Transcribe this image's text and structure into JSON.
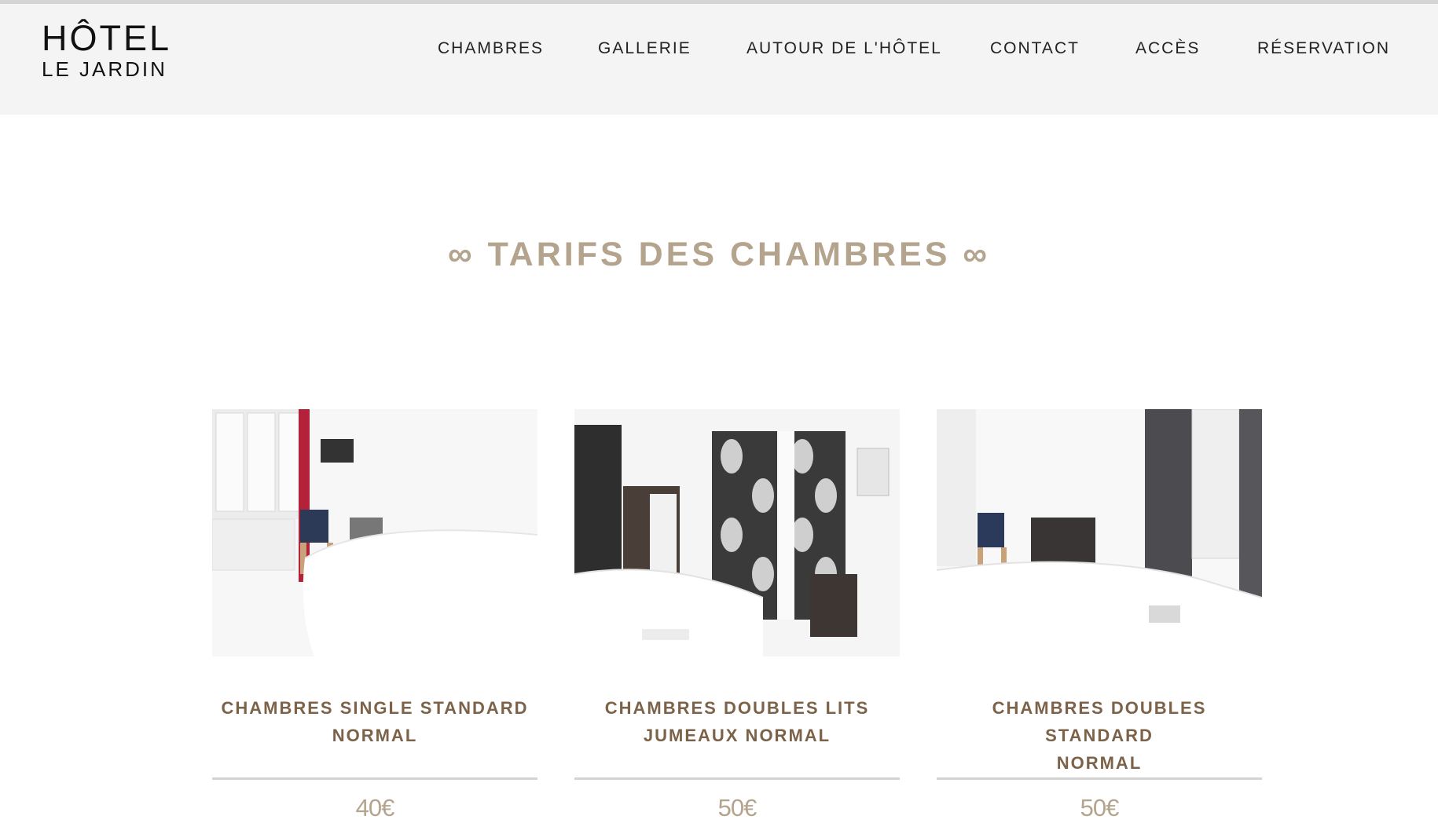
{
  "header": {
    "logo_line1": "HÔTEL",
    "logo_line2": "LE JARDIN",
    "nav": [
      {
        "label": "CHAMBRES"
      },
      {
        "label": "GALLERIE"
      },
      {
        "label": "AUTOUR DE L'HÔTEL"
      },
      {
        "label": "CONTACT"
      },
      {
        "label": "ACCÈS"
      },
      {
        "label": "RÉSERVATION"
      }
    ]
  },
  "section": {
    "title": "∞ TARIFS DES CHAMBRES ∞"
  },
  "rooms": [
    {
      "name_line1": "CHAMBRES SINGLE STANDARD",
      "name_line2": "NORMAL",
      "price": "40€"
    },
    {
      "name_line1": "CHAMBRES DOUBLES LITS",
      "name_line2": "JUMEAUX NORMAL",
      "price": "50€"
    },
    {
      "name_line1": "CHAMBRES DOUBLES STANDARD",
      "name_line2": "NORMAL",
      "price": "50€"
    }
  ],
  "colors": {
    "header_bg": "#f4f4f4",
    "title": "#b5a48d",
    "room_name": "#7b6248",
    "price": "#b5a48d"
  }
}
